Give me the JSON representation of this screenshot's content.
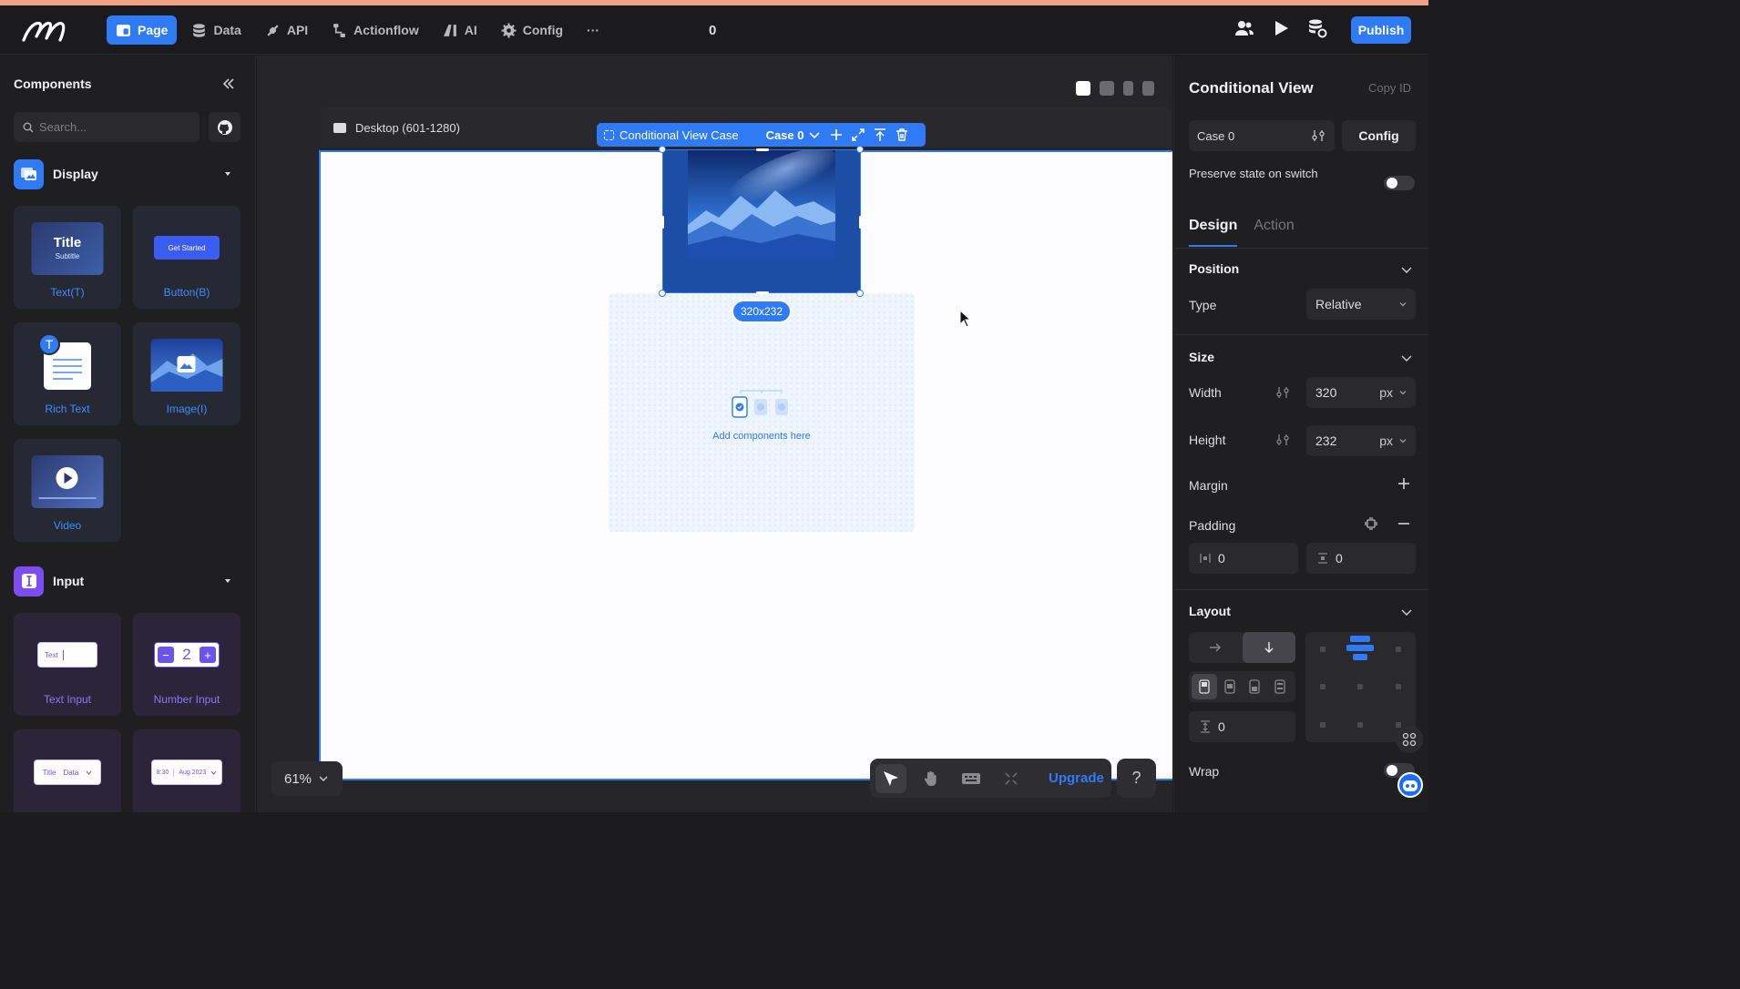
{
  "topbar": {
    "nav": [
      {
        "label": "Page",
        "icon": "page-icon",
        "active": true
      },
      {
        "label": "Data",
        "icon": "database-icon",
        "active": false
      },
      {
        "label": "API",
        "icon": "api-icon",
        "active": false
      },
      {
        "label": "Actionflow",
        "icon": "actionflow-icon",
        "active": false
      },
      {
        "label": "AI",
        "icon": "ai-icon",
        "active": false
      },
      {
        "label": "Config",
        "icon": "gear-icon",
        "active": false
      }
    ],
    "more": "···",
    "count": "0",
    "publish": "Publish",
    "accent": "#2f7bf6"
  },
  "left": {
    "title": "Components",
    "search_placeholder": "Search...",
    "display": {
      "title": "Display",
      "items": [
        {
          "label": "Text(T)",
          "thumb_title": "Title",
          "thumb_sub": "Subtitle"
        },
        {
          "label": "Button(B)",
          "thumb_btn": "Get Started"
        },
        {
          "label": "Rich Text",
          "badge": "T"
        },
        {
          "label": "Image(I)"
        },
        {
          "label": "Video"
        }
      ]
    },
    "input": {
      "title": "Input",
      "items": [
        {
          "label": "Text Input",
          "thumb": "Text"
        },
        {
          "label": "Number Input",
          "thumb": "2",
          "minus": "−",
          "plus": "+"
        },
        {
          "thumb_a": "Title",
          "thumb_b": "Data"
        },
        {
          "thumb_a": "8:30",
          "thumb_b": "Aug.2023"
        }
      ]
    }
  },
  "canvas": {
    "desktop_label": "Desktop (601-1280)",
    "cv_toolbar": {
      "label": "Conditional View Case",
      "case": "Case 0"
    },
    "size_badge": "320x232",
    "add_components": "Add components here",
    "zoom": "61%",
    "upgrade": "Upgrade",
    "help": "?"
  },
  "right": {
    "title": "Conditional View",
    "copy_id": "Copy ID",
    "case_value": "Case 0",
    "config": "Config",
    "preserve": "Preserve state on switch",
    "tabs": [
      "Design",
      "Action"
    ],
    "position": {
      "title": "Position",
      "type_label": "Type",
      "type_value": "Relative"
    },
    "size": {
      "title": "Size",
      "width_label": "Width",
      "width_value": "320",
      "width_unit": "px",
      "height_label": "Height",
      "height_value": "232",
      "height_unit": "px"
    },
    "margin_label": "Margin",
    "padding_label": "Padding",
    "padding_h": "0",
    "padding_v": "0",
    "layout": {
      "title": "Layout",
      "gap": "0"
    },
    "wrap_label": "Wrap"
  }
}
